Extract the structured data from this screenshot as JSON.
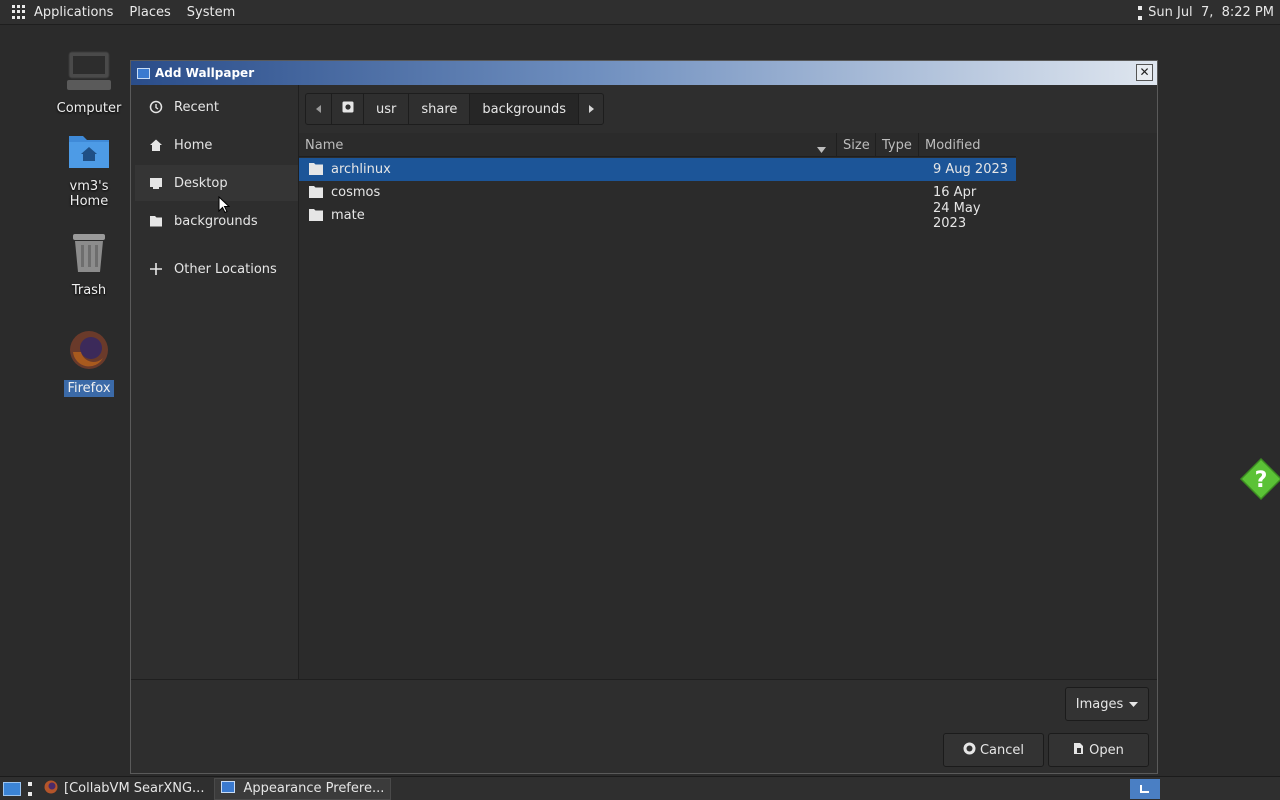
{
  "top_panel": {
    "applications": "Applications",
    "places": "Places",
    "system": "System",
    "clock": "Sun Jul  7,  8:22 PM"
  },
  "desktop": {
    "icons": [
      {
        "label": "Computer"
      },
      {
        "label": "vm3's Home"
      },
      {
        "label": "Trash"
      },
      {
        "label": "Firefox"
      }
    ]
  },
  "dialog": {
    "title": "Add Wallpaper",
    "sidebar": [
      {
        "label": "Recent",
        "icon": "clock-icon"
      },
      {
        "label": "Home",
        "icon": "home-icon"
      },
      {
        "label": "Desktop",
        "icon": "desktop-icon"
      },
      {
        "label": "backgrounds",
        "icon": "folder-icon"
      },
      {
        "label": "Other Locations",
        "icon": "plus-icon"
      }
    ],
    "path": [
      "usr",
      "share",
      "backgrounds"
    ],
    "columns": {
      "name": "Name",
      "size": "Size",
      "type": "Type",
      "modified": "Modified"
    },
    "files": [
      {
        "name": "archlinux",
        "modified": "9 Aug 2023",
        "selected": true
      },
      {
        "name": "cosmos",
        "modified": "16 Apr",
        "selected": false
      },
      {
        "name": "mate",
        "modified": "24 May 2023",
        "selected": false
      }
    ],
    "filter": "Images",
    "cancel": "Cancel",
    "open": "Open"
  },
  "taskbar": {
    "tasks": [
      "[CollabVM SearXNG...",
      "Appearance Prefere..."
    ]
  },
  "colors": {
    "selection": "#1c5598",
    "title_gradient_start": "#2a4d8a",
    "help_green": "#5bc236"
  }
}
